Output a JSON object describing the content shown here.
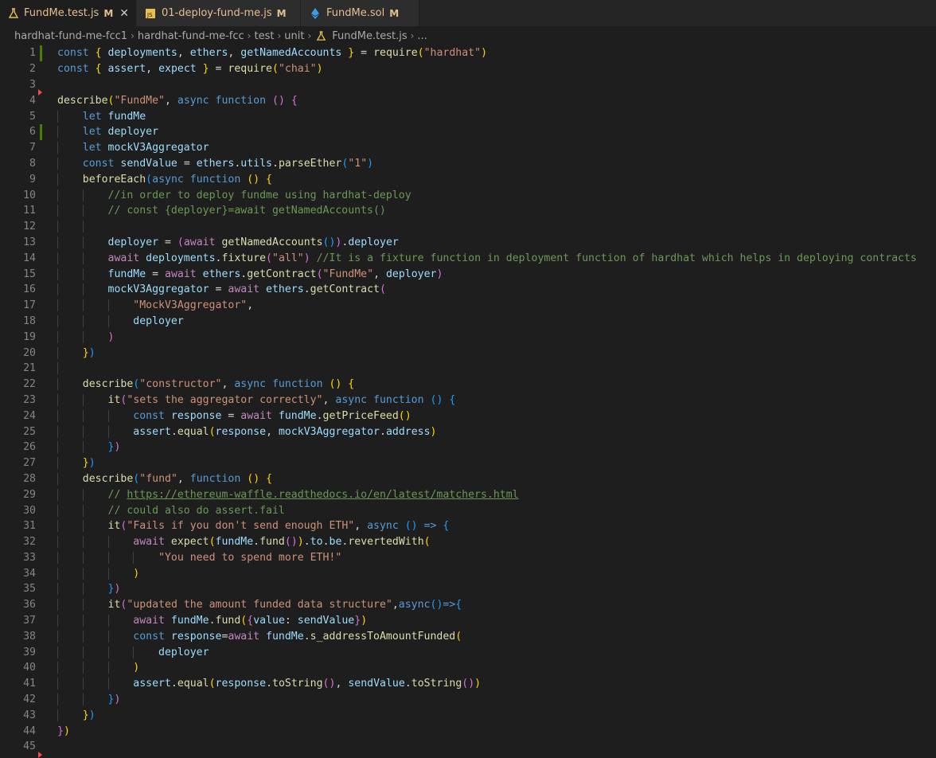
{
  "tabs": [
    {
      "icon": "flask-icon",
      "name": "FundMe.test.js",
      "modified": "M",
      "close": "✕"
    },
    {
      "icon": "js-file-icon",
      "name": "01-deploy-fund-me.js",
      "modified": "M"
    },
    {
      "icon": "ethereum-icon",
      "name": "FundMe.sol",
      "modified": "M"
    }
  ],
  "colors": {
    "accent": "#e2c08d",
    "added": "#487e02",
    "deleted": "#f14c4c",
    "background": "#1e1e1e"
  },
  "breadcrumb": [
    "hardhat-fund-me-fcc1",
    "hardhat-fund-me-fcc",
    "test",
    "unit",
    "FundMe.test.js",
    "..."
  ],
  "lines": [
    {
      "n": "1",
      "mark": "mod",
      "ind": 0,
      "t": [
        [
          "k",
          "const "
        ],
        [
          "b1",
          "{ "
        ],
        [
          "v",
          "deployments"
        ],
        [
          "p",
          ", "
        ],
        [
          "v",
          "ethers"
        ],
        [
          "p",
          ", "
        ],
        [
          "v",
          "getNamedAccounts"
        ],
        [
          "b1",
          " }"
        ],
        [
          "p",
          " = "
        ],
        [
          "f",
          "require"
        ],
        [
          "b1",
          "("
        ],
        [
          "s",
          "\"hardhat\""
        ],
        [
          "b1",
          ")"
        ]
      ]
    },
    {
      "n": "2",
      "mark": "",
      "ind": 0,
      "t": [
        [
          "k",
          "const "
        ],
        [
          "b1",
          "{ "
        ],
        [
          "v",
          "assert"
        ],
        [
          "p",
          ", "
        ],
        [
          "v",
          "expect"
        ],
        [
          "b1",
          " }"
        ],
        [
          "p",
          " = "
        ],
        [
          "f",
          "require"
        ],
        [
          "b1",
          "("
        ],
        [
          "s",
          "\"chai\""
        ],
        [
          "b1",
          ")"
        ]
      ]
    },
    {
      "n": "3",
      "mark": "del",
      "ind": 0,
      "t": []
    },
    {
      "n": "4",
      "mark": "",
      "ind": 0,
      "t": [
        [
          "f",
          "describe"
        ],
        [
          "b1",
          "("
        ],
        [
          "s",
          "\"FundMe\""
        ],
        [
          "p",
          ", "
        ],
        [
          "k",
          "async function "
        ],
        [
          "b2",
          "() {"
        ]
      ]
    },
    {
      "n": "5",
      "mark": "",
      "ind": 1,
      "t": [
        [
          "k",
          "let "
        ],
        [
          "v",
          "fundMe"
        ]
      ]
    },
    {
      "n": "6",
      "mark": "mod",
      "ind": 1,
      "t": [
        [
          "k",
          "let "
        ],
        [
          "v",
          "deployer"
        ]
      ]
    },
    {
      "n": "7",
      "mark": "",
      "ind": 1,
      "t": [
        [
          "k",
          "let "
        ],
        [
          "v",
          "mockV3Aggregator"
        ]
      ]
    },
    {
      "n": "8",
      "mark": "",
      "ind": 1,
      "t": [
        [
          "k",
          "const "
        ],
        [
          "v",
          "sendValue"
        ],
        [
          "p",
          " = "
        ],
        [
          "v",
          "ethers"
        ],
        [
          "p",
          "."
        ],
        [
          "v",
          "utils"
        ],
        [
          "p",
          "."
        ],
        [
          "f",
          "parseEther"
        ],
        [
          "b3",
          "("
        ],
        [
          "s",
          "\"1\""
        ],
        [
          "b3",
          ")"
        ]
      ]
    },
    {
      "n": "9",
      "mark": "",
      "ind": 1,
      "t": [
        [
          "f",
          "beforeEach"
        ],
        [
          "b3",
          "("
        ],
        [
          "k",
          "async function "
        ],
        [
          "b1",
          "() {"
        ]
      ]
    },
    {
      "n": "10",
      "mark": "",
      "ind": 2,
      "t": [
        [
          "cm",
          "//in order to deploy fundme using hardhat-deploy"
        ]
      ]
    },
    {
      "n": "11",
      "mark": "",
      "ind": 2,
      "t": [
        [
          "cm",
          "// const {deployer}=await getNamedAccounts()"
        ]
      ]
    },
    {
      "n": "12",
      "mark": "",
      "ind": 2,
      "t": []
    },
    {
      "n": "13",
      "mark": "",
      "ind": 2,
      "t": [
        [
          "v",
          "deployer"
        ],
        [
          "p",
          " = "
        ],
        [
          "b2",
          "("
        ],
        [
          "c",
          "await "
        ],
        [
          "f",
          "getNamedAccounts"
        ],
        [
          "b3",
          "()"
        ],
        [
          "b2",
          ")"
        ],
        [
          "p",
          "."
        ],
        [
          "v",
          "deployer"
        ]
      ]
    },
    {
      "n": "14",
      "mark": "",
      "ind": 2,
      "t": [
        [
          "c",
          "await "
        ],
        [
          "v",
          "deployments"
        ],
        [
          "p",
          "."
        ],
        [
          "f",
          "fixture"
        ],
        [
          "b2",
          "("
        ],
        [
          "s",
          "\"all\""
        ],
        [
          "b2",
          ")"
        ],
        [
          "p",
          " "
        ],
        [
          "cm",
          "//It is a fixture function in deployment function of hardhat which helps in deploying contracts"
        ]
      ]
    },
    {
      "n": "15",
      "mark": "",
      "ind": 2,
      "t": [
        [
          "v",
          "fundMe"
        ],
        [
          "p",
          " = "
        ],
        [
          "c",
          "await "
        ],
        [
          "v",
          "ethers"
        ],
        [
          "p",
          "."
        ],
        [
          "f",
          "getContract"
        ],
        [
          "b2",
          "("
        ],
        [
          "s",
          "\"FundMe\""
        ],
        [
          "p",
          ", "
        ],
        [
          "v",
          "deployer"
        ],
        [
          "b2",
          ")"
        ]
      ]
    },
    {
      "n": "16",
      "mark": "",
      "ind": 2,
      "t": [
        [
          "v",
          "mockV3Aggregator"
        ],
        [
          "p",
          " = "
        ],
        [
          "c",
          "await "
        ],
        [
          "v",
          "ethers"
        ],
        [
          "p",
          "."
        ],
        [
          "f",
          "getContract"
        ],
        [
          "b2",
          "("
        ]
      ]
    },
    {
      "n": "17",
      "mark": "",
      "ind": 3,
      "t": [
        [
          "s",
          "\"MockV3Aggregator\""
        ],
        [
          "p",
          ","
        ]
      ]
    },
    {
      "n": "18",
      "mark": "",
      "ind": 3,
      "t": [
        [
          "v",
          "deployer"
        ]
      ]
    },
    {
      "n": "19",
      "mark": "",
      "ind": 2,
      "t": [
        [
          "b2",
          ")"
        ]
      ]
    },
    {
      "n": "20",
      "mark": "",
      "ind": 1,
      "t": [
        [
          "b1",
          "}"
        ],
        [
          "b3",
          ")"
        ]
      ]
    },
    {
      "n": "21",
      "mark": "",
      "ind": 1,
      "t": []
    },
    {
      "n": "22",
      "mark": "",
      "ind": 1,
      "t": [
        [
          "f",
          "describe"
        ],
        [
          "b3",
          "("
        ],
        [
          "s",
          "\"constructor\""
        ],
        [
          "p",
          ", "
        ],
        [
          "k",
          "async function "
        ],
        [
          "b1",
          "() {"
        ]
      ]
    },
    {
      "n": "23",
      "mark": "",
      "ind": 2,
      "t": [
        [
          "f",
          "it"
        ],
        [
          "b2",
          "("
        ],
        [
          "s",
          "\"sets the aggregator correctly\""
        ],
        [
          "p",
          ", "
        ],
        [
          "k",
          "async function "
        ],
        [
          "b3",
          "() {"
        ]
      ]
    },
    {
      "n": "24",
      "mark": "",
      "ind": 3,
      "t": [
        [
          "k",
          "const "
        ],
        [
          "v",
          "response"
        ],
        [
          "p",
          " = "
        ],
        [
          "c",
          "await "
        ],
        [
          "v",
          "fundMe"
        ],
        [
          "p",
          "."
        ],
        [
          "f",
          "getPriceFeed"
        ],
        [
          "b1",
          "()"
        ]
      ]
    },
    {
      "n": "25",
      "mark": "",
      "ind": 3,
      "t": [
        [
          "v",
          "assert"
        ],
        [
          "p",
          "."
        ],
        [
          "f",
          "equal"
        ],
        [
          "b1",
          "("
        ],
        [
          "v",
          "response"
        ],
        [
          "p",
          ", "
        ],
        [
          "v",
          "mockV3Aggregator"
        ],
        [
          "p",
          "."
        ],
        [
          "v",
          "address"
        ],
        [
          "b1",
          ")"
        ]
      ]
    },
    {
      "n": "26",
      "mark": "",
      "ind": 2,
      "t": [
        [
          "b3",
          "}"
        ],
        [
          "b2",
          ")"
        ]
      ]
    },
    {
      "n": "27",
      "mark": "",
      "ind": 1,
      "t": [
        [
          "b1",
          "}"
        ],
        [
          "b3",
          ")"
        ]
      ]
    },
    {
      "n": "28",
      "mark": "",
      "ind": 1,
      "t": [
        [
          "f",
          "describe"
        ],
        [
          "b3",
          "("
        ],
        [
          "s",
          "\"fund\""
        ],
        [
          "p",
          ", "
        ],
        [
          "k",
          "function "
        ],
        [
          "b1",
          "() {"
        ]
      ]
    },
    {
      "n": "29",
      "mark": "",
      "ind": 2,
      "t": [
        [
          "cm",
          "// "
        ],
        [
          "cm u",
          "https://ethereum-waffle.readthedocs.io/en/latest/matchers.html"
        ]
      ]
    },
    {
      "n": "30",
      "mark": "",
      "ind": 2,
      "t": [
        [
          "cm",
          "// could also do assert.fail"
        ]
      ]
    },
    {
      "n": "31",
      "mark": "",
      "ind": 2,
      "t": [
        [
          "f",
          "it"
        ],
        [
          "b2",
          "("
        ],
        [
          "s",
          "\"Fails if you don't send enough ETH\""
        ],
        [
          "p",
          ", "
        ],
        [
          "k",
          "async "
        ],
        [
          "b3",
          "() "
        ],
        [
          "k",
          "=> "
        ],
        [
          "b3",
          "{"
        ]
      ]
    },
    {
      "n": "32",
      "mark": "",
      "ind": 3,
      "t": [
        [
          "c",
          "await "
        ],
        [
          "f",
          "expect"
        ],
        [
          "b1",
          "("
        ],
        [
          "v",
          "fundMe"
        ],
        [
          "p",
          "."
        ],
        [
          "f",
          "fund"
        ],
        [
          "b2",
          "()"
        ],
        [
          "b1",
          ")"
        ],
        [
          "p",
          "."
        ],
        [
          "v",
          "to"
        ],
        [
          "p",
          "."
        ],
        [
          "v",
          "be"
        ],
        [
          "p",
          "."
        ],
        [
          "f",
          "revertedWith"
        ],
        [
          "b1",
          "("
        ]
      ]
    },
    {
      "n": "33",
      "mark": "",
      "ind": 4,
      "t": [
        [
          "s",
          "\"You need to spend more ETH!\""
        ]
      ]
    },
    {
      "n": "34",
      "mark": "",
      "ind": 3,
      "t": [
        [
          "b1",
          ")"
        ]
      ]
    },
    {
      "n": "35",
      "mark": "",
      "ind": 2,
      "t": [
        [
          "b3",
          "}"
        ],
        [
          "b2",
          ")"
        ]
      ]
    },
    {
      "n": "36",
      "mark": "",
      "ind": 2,
      "t": [
        [
          "f",
          "it"
        ],
        [
          "b2",
          "("
        ],
        [
          "s",
          "\"updated the amount funded data structure\""
        ],
        [
          "p",
          ","
        ],
        [
          "k",
          "async"
        ],
        [
          "b3",
          "()"
        ],
        [
          "k",
          "=>"
        ],
        [
          "b3",
          "{"
        ]
      ]
    },
    {
      "n": "37",
      "mark": "",
      "ind": 3,
      "t": [
        [
          "c",
          "await "
        ],
        [
          "v",
          "fundMe"
        ],
        [
          "p",
          "."
        ],
        [
          "f",
          "fund"
        ],
        [
          "b1",
          "("
        ],
        [
          "b2",
          "{"
        ],
        [
          "v",
          "value"
        ],
        [
          "p",
          ": "
        ],
        [
          "v",
          "sendValue"
        ],
        [
          "b2",
          "}"
        ],
        [
          "b1",
          ")"
        ]
      ]
    },
    {
      "n": "38",
      "mark": "",
      "ind": 3,
      "t": [
        [
          "k",
          "const "
        ],
        [
          "v",
          "response"
        ],
        [
          "p",
          "="
        ],
        [
          "c",
          "await "
        ],
        [
          "v",
          "fundMe"
        ],
        [
          "p",
          "."
        ],
        [
          "f",
          "s_addressToAmountFunded"
        ],
        [
          "b1",
          "("
        ]
      ]
    },
    {
      "n": "39",
      "mark": "",
      "ind": 4,
      "t": [
        [
          "v",
          "deployer"
        ]
      ]
    },
    {
      "n": "40",
      "mark": "",
      "ind": 3,
      "t": [
        [
          "b1",
          ")"
        ]
      ]
    },
    {
      "n": "41",
      "mark": "",
      "ind": 3,
      "t": [
        [
          "v",
          "assert"
        ],
        [
          "p",
          "."
        ],
        [
          "f",
          "equal"
        ],
        [
          "b1",
          "("
        ],
        [
          "v",
          "response"
        ],
        [
          "p",
          "."
        ],
        [
          "f",
          "toString"
        ],
        [
          "b2",
          "()"
        ],
        [
          "p",
          ", "
        ],
        [
          "v",
          "sendValue"
        ],
        [
          "p",
          "."
        ],
        [
          "f",
          "toString"
        ],
        [
          "b2",
          "()"
        ],
        [
          "b1",
          ")"
        ]
      ]
    },
    {
      "n": "42",
      "mark": "",
      "ind": 2,
      "t": [
        [
          "b3",
          "}"
        ],
        [
          "b2",
          ")"
        ]
      ]
    },
    {
      "n": "43",
      "mark": "",
      "ind": 1,
      "t": [
        [
          "b1",
          "}"
        ],
        [
          "b3",
          ")"
        ]
      ]
    },
    {
      "n": "44",
      "mark": "",
      "ind": 0,
      "t": [
        [
          "b2",
          "}"
        ],
        [
          "b1",
          ")"
        ]
      ]
    },
    {
      "n": "45",
      "mark": "del",
      "ind": 0,
      "t": []
    }
  ]
}
